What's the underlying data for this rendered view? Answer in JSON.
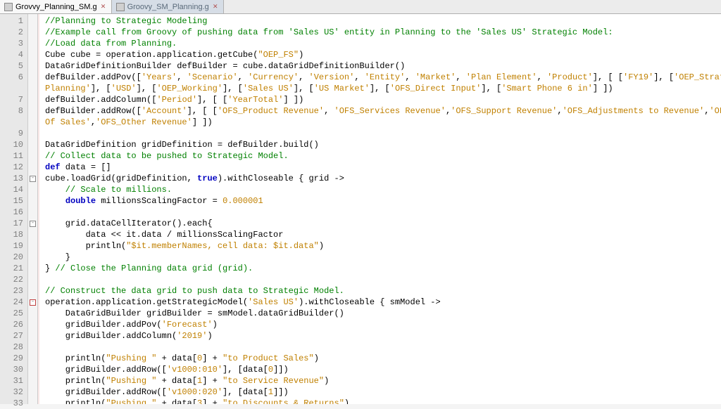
{
  "tabs": [
    {
      "label": "Grovvy_Planning_SM.g",
      "active": true
    },
    {
      "label": "Groovy_SM_Planning.g",
      "active": false
    }
  ],
  "code_lines": [
    {
      "n": 1,
      "kind": "comment",
      "text": "//Planning to Strategic Modeling"
    },
    {
      "n": 2,
      "kind": "comment",
      "text": "//Example call from Groovy of pushing data from 'Sales US' entity in Planning to the 'Sales US' Strategic Model:"
    },
    {
      "n": 3,
      "kind": "comment",
      "text": "//Load data from Planning."
    },
    {
      "n": 4,
      "kind": "code",
      "tokens": [
        "Cube cube = operation.application.getCube(",
        {
          "t": "\"OEP_FS\"",
          "c": "st"
        },
        ")"
      ]
    },
    {
      "n": 5,
      "kind": "code",
      "tokens": [
        "DataGridDefinitionBuilder defBuilder = cube.dataGridDefinitionBuilder()"
      ]
    },
    {
      "n": 6,
      "kind": "code",
      "tokens": [
        "defBuilder.addPov([",
        {
          "t": "'Years'",
          "c": "st"
        },
        ", ",
        {
          "t": "'Scenario'",
          "c": "st"
        },
        ", ",
        {
          "t": "'Currency'",
          "c": "st"
        },
        ", ",
        {
          "t": "'Version'",
          "c": "st"
        },
        ", ",
        {
          "t": "'Entity'",
          "c": "st"
        },
        ", ",
        {
          "t": "'Market'",
          "c": "st"
        },
        ", ",
        {
          "t": "'Plan Element'",
          "c": "st"
        },
        ", ",
        {
          "t": "'Product'",
          "c": "st"
        },
        "], [ [",
        {
          "t": "'FY19'",
          "c": "st"
        },
        "], [",
        {
          "t": "'OEP_Strategic",
          "c": "st"
        }
      ]
    },
    {
      "n": 0,
      "kind": "wrap",
      "tokens": [
        {
          "t": "Planning'",
          "c": "st"
        },
        "], [",
        {
          "t": "'USD'",
          "c": "st"
        },
        "], [",
        {
          "t": "'OEP_Working'",
          "c": "st"
        },
        "], [",
        {
          "t": "'Sales US'",
          "c": "st"
        },
        "], [",
        {
          "t": "'US Market'",
          "c": "st"
        },
        "], [",
        {
          "t": "'OFS_Direct Input'",
          "c": "st"
        },
        "], [",
        {
          "t": "'Smart Phone 6 in'",
          "c": "st"
        },
        "] ])"
      ]
    },
    {
      "n": 7,
      "kind": "code",
      "tokens": [
        "defBuilder.addColumn([",
        {
          "t": "'Period'",
          "c": "st"
        },
        "], [ [",
        {
          "t": "'YearTotal'",
          "c": "st"
        },
        "] ])"
      ]
    },
    {
      "n": 8,
      "kind": "code",
      "tokens": [
        "defBuilder.addRow([",
        {
          "t": "'Account'",
          "c": "st"
        },
        "], [ [",
        {
          "t": "'OFS_Product Revenue'",
          "c": "st"
        },
        ", ",
        {
          "t": "'OFS_Services Revenue'",
          "c": "st"
        },
        ",",
        {
          "t": "'OFS_Support Revenue'",
          "c": "st"
        },
        ",",
        {
          "t": "'OFS_Adjustments to Revenue'",
          "c": "st"
        },
        ",",
        {
          "t": "'OFS_Total Cost",
          "c": "st"
        }
      ]
    },
    {
      "n": 0,
      "kind": "wrap",
      "tokens": [
        {
          "t": "Of Sales'",
          "c": "st"
        },
        ",",
        {
          "t": "'OFS_Other Revenue'",
          "c": "st"
        },
        "] ])"
      ]
    },
    {
      "n": 9,
      "kind": "blank",
      "text": ""
    },
    {
      "n": 10,
      "kind": "code",
      "tokens": [
        "DataGridDefinition gridDefinition = defBuilder.build()"
      ]
    },
    {
      "n": 11,
      "kind": "comment",
      "text": "// Collect data to be pushed to Strategic Model."
    },
    {
      "n": 12,
      "kind": "code",
      "tokens": [
        {
          "t": "def",
          "c": "kw"
        },
        " data = []"
      ]
    },
    {
      "n": 13,
      "kind": "code",
      "fold": "open",
      "tokens": [
        "cube.loadGrid(gridDefinition, ",
        {
          "t": "true",
          "c": "kw"
        },
        ").withCloseable { grid ->"
      ]
    },
    {
      "n": 14,
      "kind": "comment",
      "indent": 1,
      "text": "// Scale to millions."
    },
    {
      "n": 15,
      "kind": "code",
      "indent": 1,
      "tokens": [
        {
          "t": "double",
          "c": "kw"
        },
        " millionsScalingFactor = ",
        {
          "t": "0.000001",
          "c": "nm"
        }
      ]
    },
    {
      "n": 16,
      "kind": "blank",
      "text": ""
    },
    {
      "n": 17,
      "kind": "code",
      "indent": 1,
      "fold": "open",
      "tokens": [
        "grid.dataCellIterator().each{"
      ]
    },
    {
      "n": 18,
      "kind": "code",
      "indent": 2,
      "tokens": [
        "data << it.data / millionsScalingFactor"
      ]
    },
    {
      "n": 19,
      "kind": "code",
      "indent": 2,
      "tokens": [
        "println(",
        {
          "t": "\"$it.memberNames, cell data: $it.data\"",
          "c": "st"
        },
        ")"
      ]
    },
    {
      "n": 20,
      "kind": "code",
      "indent": 1,
      "tokens": [
        "}"
      ]
    },
    {
      "n": 21,
      "kind": "code",
      "tokens": [
        "} ",
        {
          "t": "// Close the Planning data grid (grid).",
          "c": "cm"
        }
      ]
    },
    {
      "n": 22,
      "kind": "blank",
      "text": ""
    },
    {
      "n": 23,
      "kind": "comment",
      "text": "// Construct the data grid to push data to Strategic Model."
    },
    {
      "n": 24,
      "kind": "code",
      "fold": "open-red",
      "tokens": [
        "operation.application.getStrategicModel(",
        {
          "t": "'Sales US'",
          "c": "st"
        },
        ").withCloseable { smModel ->"
      ]
    },
    {
      "n": 25,
      "kind": "code",
      "indent": 1,
      "tokens": [
        "DataGridBuilder gridBuilder = smModel.dataGridBuilder()"
      ]
    },
    {
      "n": 26,
      "kind": "code",
      "indent": 1,
      "tokens": [
        "gridBuilder.addPov(",
        {
          "t": "'Forecast'",
          "c": "st"
        },
        ")"
      ]
    },
    {
      "n": 27,
      "kind": "code",
      "indent": 1,
      "tokens": [
        "gridBuilder.addColumn(",
        {
          "t": "'2019'",
          "c": "st"
        },
        ")"
      ]
    },
    {
      "n": 28,
      "kind": "blank",
      "text": ""
    },
    {
      "n": 29,
      "kind": "code",
      "indent": 1,
      "tokens": [
        "println(",
        {
          "t": "\"Pushing \"",
          "c": "st"
        },
        " + data[",
        {
          "t": "0",
          "c": "nm"
        },
        "] + ",
        {
          "t": "\"to Product Sales\"",
          "c": "st"
        },
        ")"
      ]
    },
    {
      "n": 30,
      "kind": "code",
      "indent": 1,
      "tokens": [
        "gridBuilder.addRow([",
        {
          "t": "'v1000:010'",
          "c": "st"
        },
        "], [data[",
        {
          "t": "0",
          "c": "nm"
        },
        "]])"
      ]
    },
    {
      "n": 31,
      "kind": "code",
      "indent": 1,
      "tokens": [
        "println(",
        {
          "t": "\"Pushing \"",
          "c": "st"
        },
        " + data[",
        {
          "t": "1",
          "c": "nm"
        },
        "] + ",
        {
          "t": "\"to Service Revenue\"",
          "c": "st"
        },
        ")"
      ]
    },
    {
      "n": 32,
      "kind": "code",
      "indent": 1,
      "tokens": [
        "gridBuilder.addRow([",
        {
          "t": "'v1000:020'",
          "c": "st"
        },
        "], [data[",
        {
          "t": "1",
          "c": "nm"
        },
        "]])"
      ]
    },
    {
      "n": 33,
      "kind": "code",
      "indent": 1,
      "tokens": [
        "println(",
        {
          "t": "\"Pushing \"",
          "c": "st"
        },
        " + data[",
        {
          "t": "3",
          "c": "nm"
        },
        "] + ",
        {
          "t": "\"to Discounts & Returns\"",
          "c": "st"
        },
        ")"
      ]
    }
  ]
}
